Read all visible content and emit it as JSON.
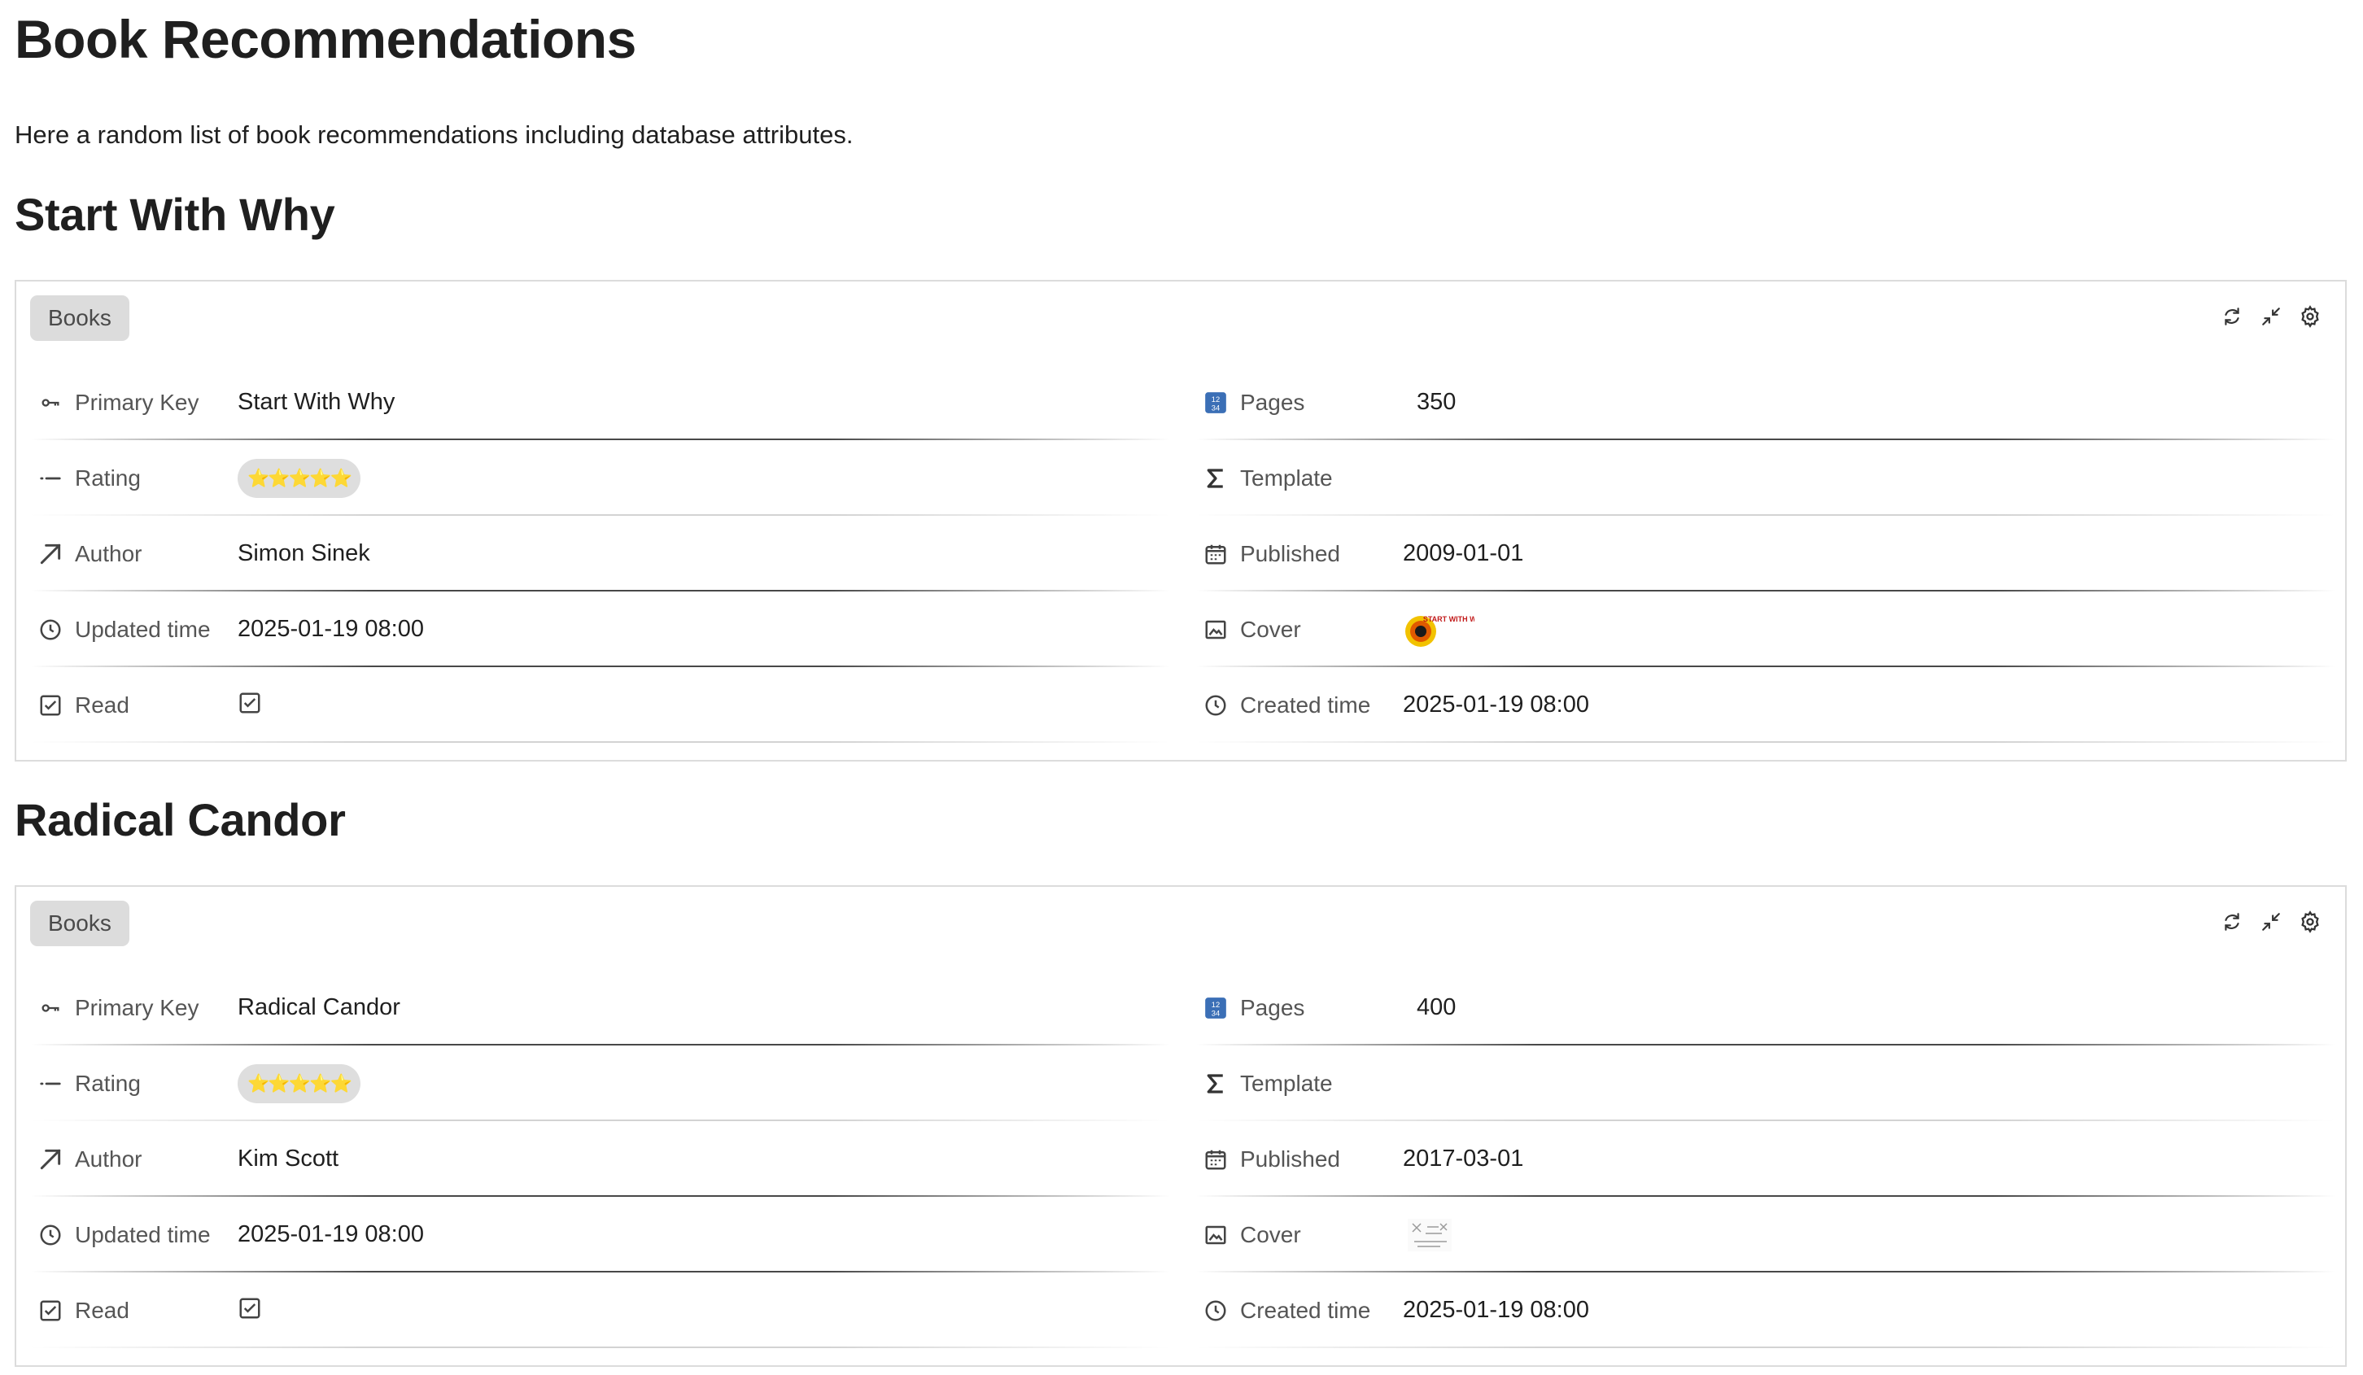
{
  "page": {
    "title": "Book Recommendations",
    "intro": "Here a random list of book recommendations including database attributes."
  },
  "books": [
    {
      "heading": "Start With Why",
      "tag": "Books",
      "fields": {
        "primary_key": {
          "label": "Primary Key",
          "value": "Start With Why"
        },
        "rating": {
          "label": "Rating",
          "value": "⭐⭐⭐⭐⭐"
        },
        "author": {
          "label": "Author",
          "value": "Simon Sinek"
        },
        "updated_time": {
          "label": "Updated time",
          "value": "2025-01-19 08:00"
        },
        "read": {
          "label": "Read",
          "checked": true
        },
        "pages": {
          "label": "Pages",
          "value": "350"
        },
        "template": {
          "label": "Template",
          "value": ""
        },
        "published": {
          "label": "Published",
          "value": "2009-01-01"
        },
        "cover": {
          "label": "Cover",
          "thumb_text": "START WITH WHY"
        },
        "created_time": {
          "label": "Created time",
          "value": "2025-01-19 08:00"
        }
      }
    },
    {
      "heading": "Radical Candor",
      "tag": "Books",
      "fields": {
        "primary_key": {
          "label": "Primary Key",
          "value": "Radical Candor"
        },
        "rating": {
          "label": "Rating",
          "value": "⭐⭐⭐⭐⭐"
        },
        "author": {
          "label": "Author",
          "value": "Kim Scott"
        },
        "updated_time": {
          "label": "Updated time",
          "value": "2025-01-19 08:00"
        },
        "read": {
          "label": "Read",
          "checked": true
        },
        "pages": {
          "label": "Pages",
          "value": "400"
        },
        "template": {
          "label": "Template",
          "value": ""
        },
        "published": {
          "label": "Published",
          "value": "2017-03-01"
        },
        "cover": {
          "label": "Cover"
        },
        "created_time": {
          "label": "Created time",
          "value": "2025-01-19 08:00"
        }
      }
    }
  ],
  "icons": {
    "primary_key": "key-icon",
    "rating": "list-dash-icon",
    "author": "arrow-up-right-icon",
    "updated_time": "clock-icon",
    "read": "checkbox-icon",
    "pages": "number-grid-icon",
    "template": "sigma-icon",
    "published": "calendar-icon",
    "cover": "image-icon",
    "created_time": "clock-icon",
    "toolbar": [
      "refresh-icon",
      "collapse-icon",
      "gear-icon"
    ]
  },
  "colors": {
    "tag_bg": "#dcdcdc",
    "card_border": "#dcdcdc",
    "label_text": "#555555",
    "value_text": "#1f1f1f",
    "pages_icon_blue": "#3b6fb6"
  }
}
